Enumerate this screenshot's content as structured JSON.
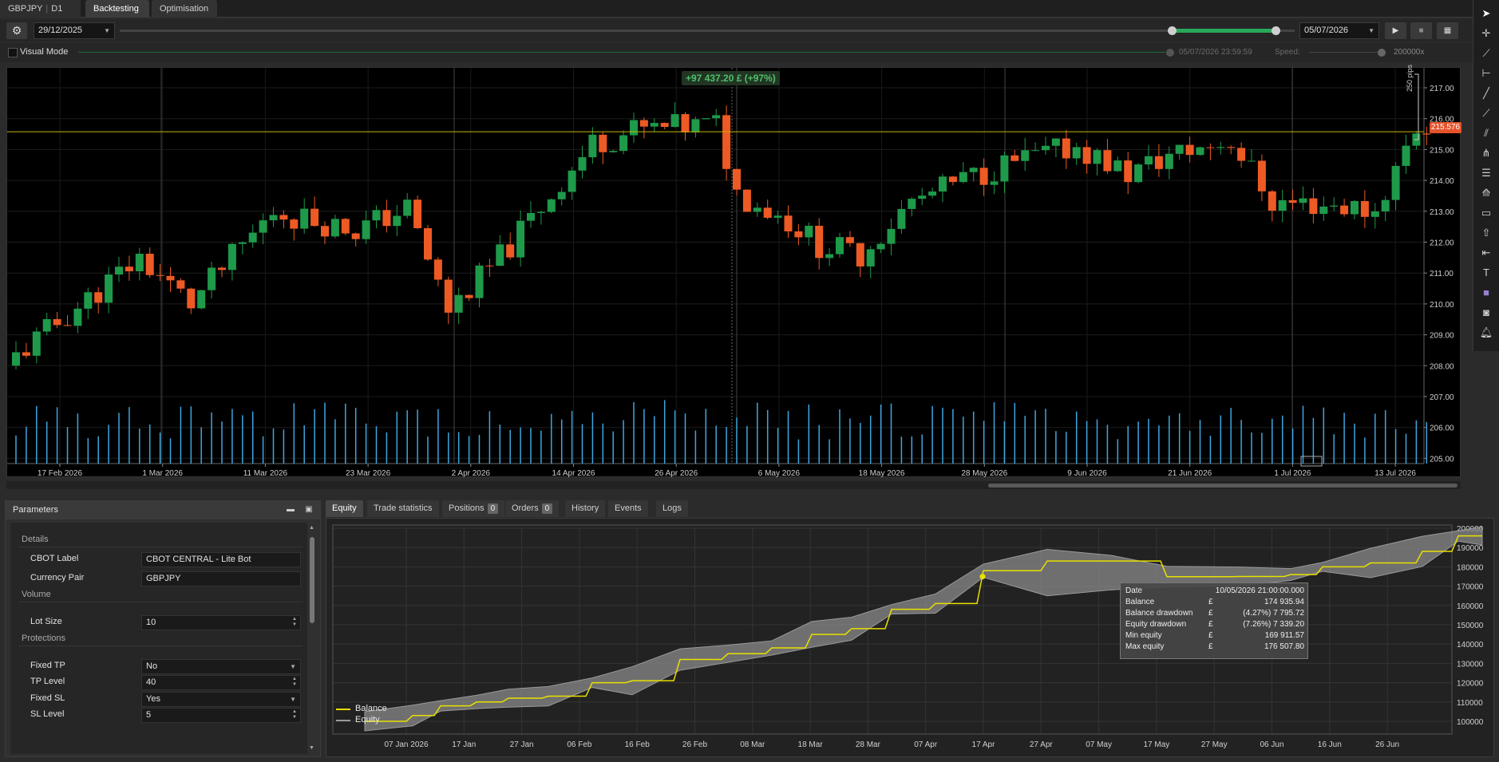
{
  "tabs": {
    "symbol": "GBPJPY",
    "timeframe": "D1",
    "backtesting": "Backtesting",
    "optimisation": "Optimisation"
  },
  "controls": {
    "date_from": "29/12/2025",
    "date_to": "05/07/2026",
    "visual_mode_label": "Visual Mode",
    "visual_mode_time": "05/07/2026 23:59:59",
    "speed_label": "Speed:",
    "speed_value": "200000x"
  },
  "chart": {
    "pnl_badge": "+97 437.20 £ (+97%)",
    "current_price": "215.576",
    "pips_label": "250 pips",
    "colors": {
      "bull": "#1e9a4a",
      "bear": "#ee5a24",
      "volume": "#3ea6e0",
      "price_line": "#c8b400"
    },
    "y_ticks": [
      "217.00",
      "216.00",
      "215.00",
      "214.00",
      "213.00",
      "212.00",
      "211.00",
      "210.00",
      "209.00",
      "208.00",
      "207.00",
      "206.00",
      "205.00"
    ],
    "x_ticks": [
      "17 Feb 2026",
      "1 Mar 2026",
      "11 Mar 2026",
      "23 Mar 2026",
      "2 Apr 2026",
      "14 Apr 2026",
      "26 Apr 2026",
      "6 May 2026",
      "18 May 2026",
      "28 May 2026",
      "9 Jun 2026",
      "21 Jun 2026",
      "1 Jul 2026",
      "13 Jul 2026"
    ]
  },
  "params": {
    "title": "Parameters",
    "groups": {
      "details": "Details",
      "volume": "Volume",
      "protections": "Protections"
    },
    "rows": {
      "cbot_label": {
        "label": "CBOT Label",
        "value": "CBOT CENTRAL - Lite Bot"
      },
      "currency_pair": {
        "label": "Currency Pair",
        "value": "GBPJPY"
      },
      "lot_size": {
        "label": "Lot Size",
        "value": "10"
      },
      "fixed_tp": {
        "label": "Fixed TP",
        "value": "No"
      },
      "tp_level": {
        "label": "TP Level",
        "value": "40"
      },
      "fixed_sl": {
        "label": "Fixed SL",
        "value": "Yes"
      },
      "sl_level": {
        "label": "SL Level",
        "value": "5"
      }
    }
  },
  "bottom_tabs": {
    "equity": "Equity",
    "trade_statistics": "Trade statistics",
    "positions": "Positions",
    "positions_count": "0",
    "orders": "Orders",
    "orders_count": "0",
    "history": "History",
    "events": "Events",
    "logs": "Logs"
  },
  "equity": {
    "y_ticks": [
      "200000",
      "190000",
      "180000",
      "170000",
      "160000",
      "150000",
      "140000",
      "130000",
      "120000",
      "110000",
      "100000"
    ],
    "x_ticks": [
      "07 Jan 2026",
      "17 Jan",
      "27 Jan",
      "06 Feb",
      "16 Feb",
      "26 Feb",
      "08 Mar",
      "18 Mar",
      "28 Mar",
      "07 Apr",
      "17 Apr",
      "27 Apr",
      "07 May",
      "17 May",
      "27 May",
      "06 Jun",
      "16 Jun",
      "26 Jun"
    ],
    "legend": {
      "balance": "Balance",
      "equity": "Equity"
    },
    "colors": {
      "balance": "#e8e000",
      "equity": "#9a9a9a"
    },
    "tooltip": {
      "date_label": "Date",
      "date_value": "10/05/2026 21:00:00.000",
      "balance_label": "Balance",
      "balance_cur": "£",
      "balance_value": "174 935.94",
      "bdd_label": "Balance drawdown",
      "bdd_cur": "£",
      "bdd_value": "(4.27%) 7 795.72",
      "edd_label": "Equity drawdown",
      "edd_cur": "£",
      "edd_value": "(7.26%) 7 339.20",
      "min_label": "Min equity",
      "min_cur": "£",
      "min_value": "169 911.57",
      "max_label": "Max equity",
      "max_cur": "£",
      "max_value": "176 507.80"
    }
  }
}
